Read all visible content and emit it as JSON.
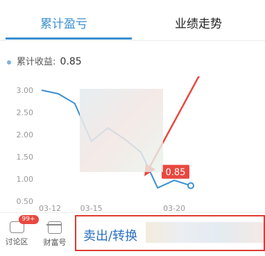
{
  "tabs": [
    {
      "label": "累计盈亏",
      "active": true
    },
    {
      "label": "业绩走势",
      "active": false
    }
  ],
  "legend": {
    "label": "累计收益:",
    "value": "0.85"
  },
  "chart_data": {
    "type": "line",
    "x": [
      "03-12",
      "03-13",
      "03-14",
      "03-15",
      "03-16",
      "03-17",
      "03-18",
      "03-19",
      "03-20",
      "03-21"
    ],
    "values": [
      3.0,
      2.92,
      2.7,
      1.85,
      2.15,
      1.9,
      1.6,
      0.8,
      0.97,
      0.85
    ],
    "ylim": [
      0.5,
      3.0
    ],
    "yticks": [
      "0.50",
      "1.00",
      "1.50",
      "2.00",
      "2.50",
      "3.00"
    ],
    "xticks": [
      "03-12",
      "03-15",
      "03-20"
    ],
    "last_label": "0.85",
    "grid": false,
    "colors": {
      "line": "#3a8fd0",
      "marker": "#e8483f",
      "arrow": "#e8483f"
    }
  },
  "bottom": {
    "discussion": {
      "label": "讨论区",
      "badge": "99+"
    },
    "wealth": {
      "label": "财富号"
    },
    "sell": {
      "label": "卖出/转换"
    }
  }
}
